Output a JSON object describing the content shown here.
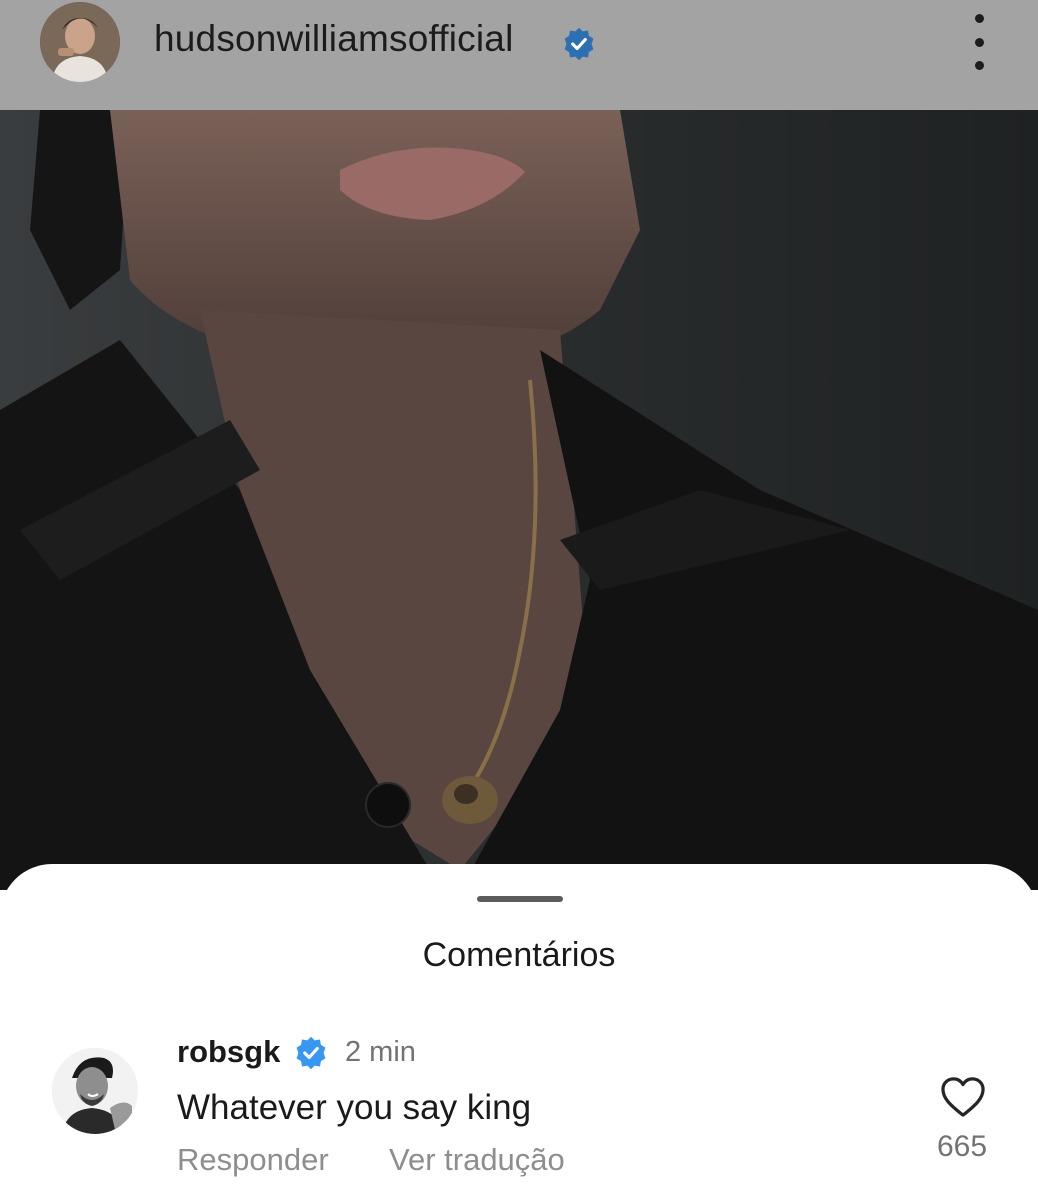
{
  "post": {
    "username": "hudsonwilliamsofficial",
    "verified": true,
    "menu_icon": "more-vertical-icon"
  },
  "comments_sheet": {
    "title": "Comentários",
    "comments": [
      {
        "username": "robsgk",
        "verified": true,
        "time": "2 min",
        "text": "Whatever you say king",
        "reply_label": "Responder",
        "translate_label": "Ver tradução",
        "likes": "665",
        "like_icon": "heart-icon"
      }
    ]
  },
  "colors": {
    "verified_blue": "#3897f0",
    "overlay_gray": "#a3a3a3"
  }
}
